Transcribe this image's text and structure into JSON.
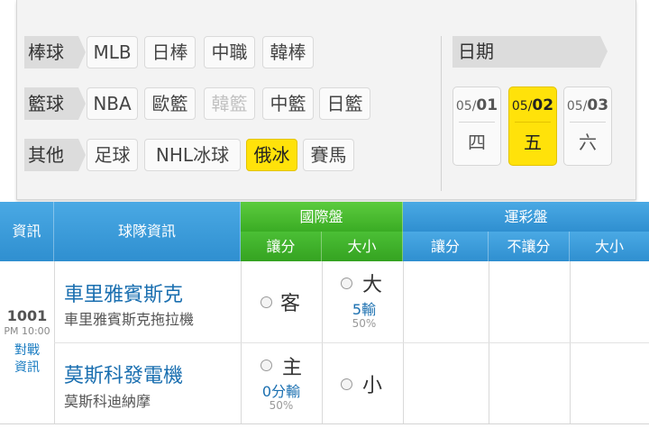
{
  "filters": {
    "rows": [
      {
        "category": "棒球",
        "items": [
          {
            "label": "MLB",
            "state": "normal"
          },
          {
            "label": "日棒",
            "state": "normal"
          },
          {
            "label": "中職",
            "state": "normal"
          },
          {
            "label": "韓棒",
            "state": "normal"
          }
        ]
      },
      {
        "category": "籃球",
        "items": [
          {
            "label": "NBA",
            "state": "normal"
          },
          {
            "label": "歐籃",
            "state": "normal"
          },
          {
            "label": "韓籃",
            "state": "disabled"
          },
          {
            "label": "中籃",
            "state": "normal"
          },
          {
            "label": "日籃",
            "state": "normal"
          }
        ]
      },
      {
        "category": "其他",
        "items": [
          {
            "label": "足球",
            "state": "normal"
          },
          {
            "label": "NHL冰球",
            "state": "normal"
          },
          {
            "label": "俄冰",
            "state": "active"
          },
          {
            "label": "賽馬",
            "state": "normal"
          }
        ]
      }
    ],
    "date_label": "日期",
    "dates": [
      {
        "month": "05/",
        "day": "01",
        "weekday": "四",
        "active": false
      },
      {
        "month": "05/",
        "day": "02",
        "weekday": "五",
        "active": true
      },
      {
        "month": "05/",
        "day": "03",
        "weekday": "六",
        "active": false
      }
    ]
  },
  "table": {
    "headers": {
      "info": "資訊",
      "team": "球隊資訊",
      "intl": "國際盤",
      "intl_spread": "讓分",
      "intl_total": "大小",
      "lottery": "運彩盤",
      "lot_spread": "讓分",
      "lot_no_spread": "不讓分",
      "lot_total": "大小"
    },
    "game": {
      "id": "1001",
      "time": "PM 10:00",
      "link1": "對戰",
      "link2": "資訊",
      "away": {
        "name": "車里雅賓斯克",
        "subname": "車里雅賓斯克拖拉機",
        "spread_side": "客",
        "total_side": "大",
        "total_odds": "5輸",
        "total_pct": "50%"
      },
      "home": {
        "name": "莫斯科發電機",
        "subname": "莫斯科迪納摩",
        "spread_side": "主",
        "spread_odds": "0分輸",
        "spread_pct": "50%",
        "total_side": "小"
      }
    }
  },
  "colors": {
    "active": "#ffe20a",
    "header_blue": "#3a9ad8",
    "header_green": "#4bbf35",
    "team_blue": "#1a6fb0"
  }
}
